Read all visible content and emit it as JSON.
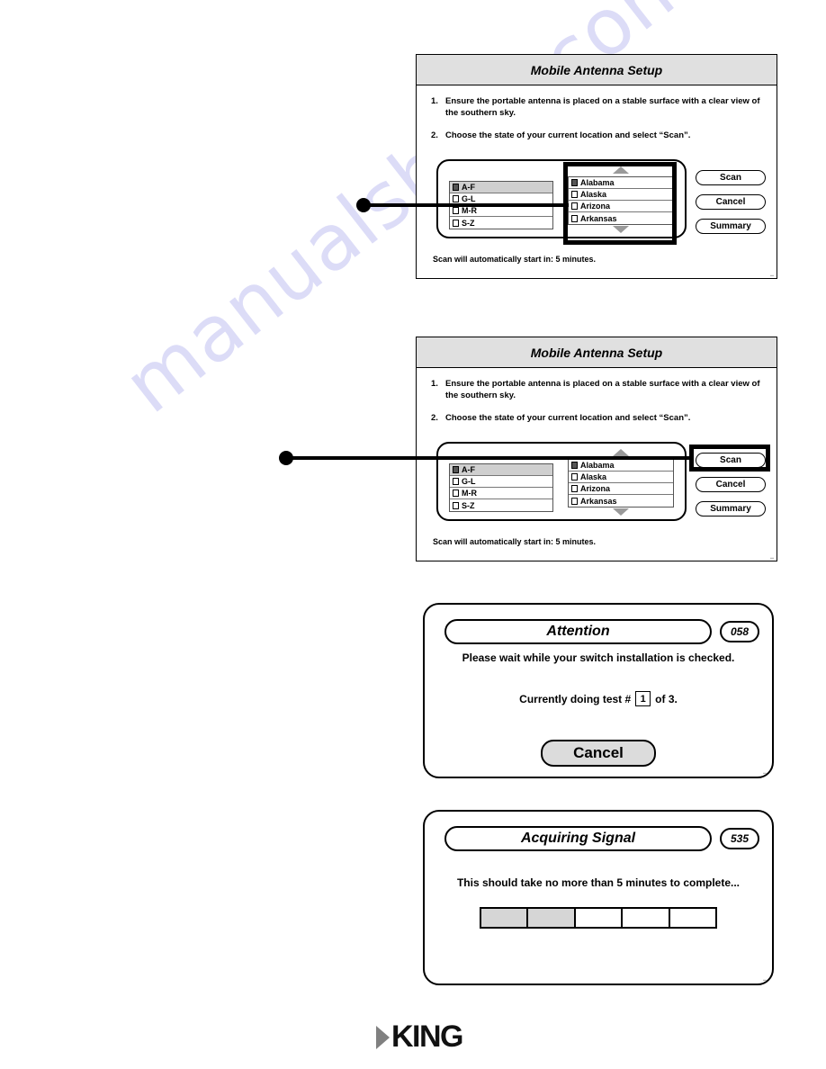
{
  "watermark": "manualshive.com",
  "brand": {
    "logo_text": "KING",
    "triangle_color": "#808080"
  },
  "panels": [
    {
      "id": "mobile-antenna-setup-1",
      "title": "Mobile Antenna Setup",
      "steps": [
        {
          "num": "1.",
          "text": "Ensure the portable antenna is placed on a stable surface with a clear view of the southern sky."
        },
        {
          "num": "2.",
          "text": "Choose the state of your current location and select “Scan”."
        }
      ],
      "group_list": {
        "rows": [
          {
            "label": "A-F",
            "selected": true
          },
          {
            "label": "G-L",
            "selected": false
          },
          {
            "label": "M-R",
            "selected": false
          },
          {
            "label": "S-Z",
            "selected": false
          }
        ]
      },
      "state_list": {
        "scroll_up": "scroll-up-arrow",
        "scroll_down": "scroll-down-arrow",
        "rows": [
          {
            "label": "Alabama",
            "selected": true
          },
          {
            "label": "Alaska",
            "selected": false
          },
          {
            "label": "Arizona",
            "selected": false
          },
          {
            "label": "Arkansas",
            "selected": false
          }
        ]
      },
      "buttons": [
        {
          "label": "Scan"
        },
        {
          "label": "Cancel"
        },
        {
          "label": "Summary"
        }
      ],
      "footnote": "Scan will automatically start in: 5 minutes.",
      "highlight_target": "state-list"
    },
    {
      "id": "mobile-antenna-setup-2",
      "title": "Mobile Antenna Setup",
      "steps": [
        {
          "num": "1.",
          "text": "Ensure the portable antenna is placed on a stable surface with a clear view of the southern sky."
        },
        {
          "num": "2.",
          "text": "Choose the state of your current location and select “Scan”."
        }
      ],
      "group_list": {
        "rows": [
          {
            "label": "A-F",
            "selected": true
          },
          {
            "label": "G-L",
            "selected": false
          },
          {
            "label": "M-R",
            "selected": false
          },
          {
            "label": "S-Z",
            "selected": false
          }
        ]
      },
      "state_list": {
        "scroll_up": "scroll-up-arrow",
        "scroll_down": "scroll-down-arrow",
        "rows": [
          {
            "label": "Alabama",
            "selected": true
          },
          {
            "label": "Alaska",
            "selected": false
          },
          {
            "label": "Arizona",
            "selected": false
          },
          {
            "label": "Arkansas",
            "selected": false
          }
        ]
      },
      "buttons": [
        {
          "label": "Scan"
        },
        {
          "label": "Cancel"
        },
        {
          "label": "Summary"
        }
      ],
      "footnote": "Scan will automatically start in: 5 minutes.",
      "highlight_target": "scan-button"
    }
  ],
  "attention_dialog": {
    "title": "Attention",
    "badge": "058",
    "message": "Please wait while your switch installation is checked.",
    "test_prefix": "Currently doing test  #",
    "test_current": "1",
    "test_suffix": "of  3.",
    "cancel_label": "Cancel"
  },
  "acquiring_dialog": {
    "title": "Acquiring Signal",
    "badge": "535",
    "message": "This should take no more than 5 minutes to complete...",
    "progress": {
      "segments": 5,
      "filled": 2
    }
  }
}
